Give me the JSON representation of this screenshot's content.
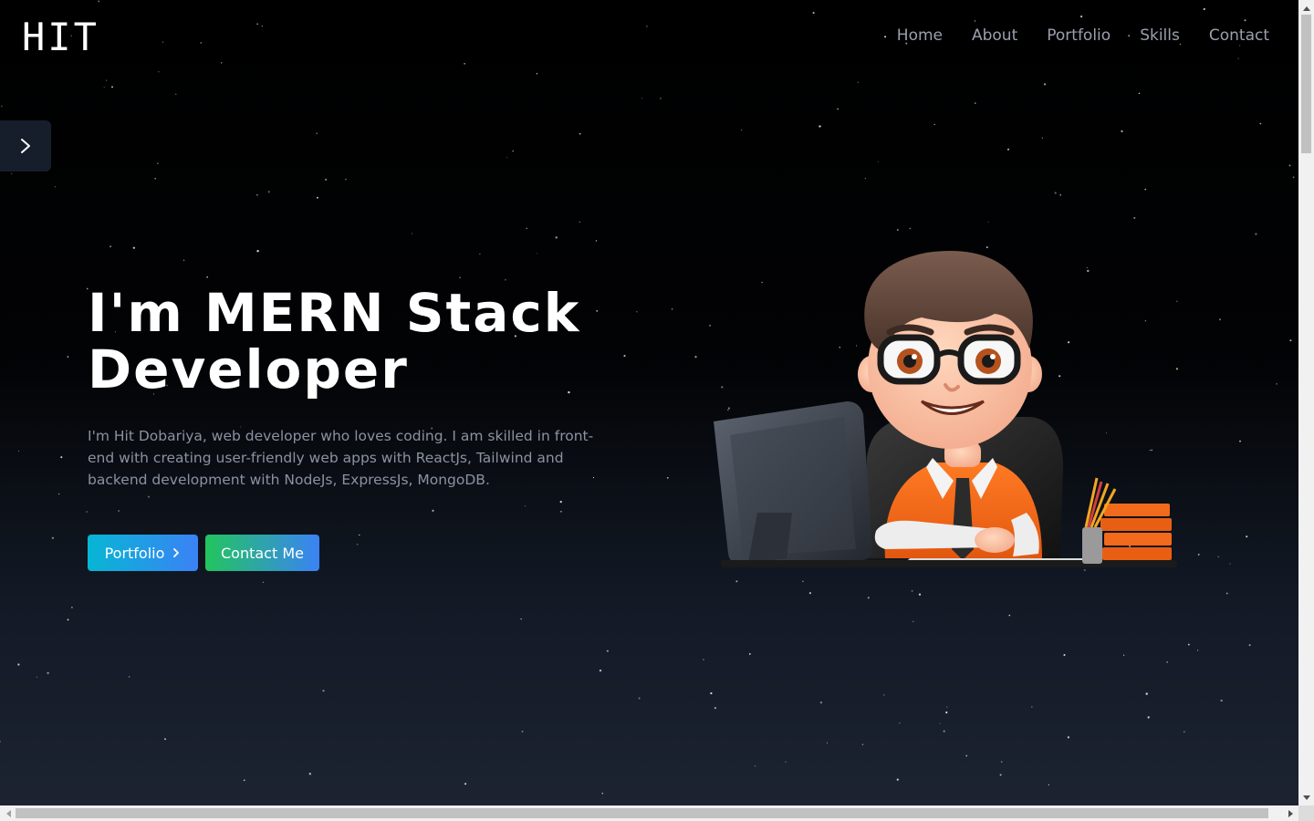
{
  "header": {
    "logo": "HIT",
    "nav": [
      "Home",
      "About",
      "Portfolio",
      "Skills",
      "Contact"
    ]
  },
  "sidebar_toggle": {
    "icon": "chevron-right-icon"
  },
  "hero": {
    "title_line1": "I'm MERN Stack",
    "title_line2": "Developer",
    "description": "I'm Hit Dobariya, web developer who loves coding. I am skilled in front-end with creating user-friendly web apps with ReactJs, Tailwind and backend development with NodeJs, ExpressJs, MongoDB.",
    "buttons": {
      "portfolio": "Portfolio",
      "contact": "Contact Me"
    },
    "illustration": "3D cartoon developer with glasses sitting at a computer desk"
  },
  "colors": {
    "background_top": "#000000",
    "background_bottom": "#1c2331",
    "nav_text": "#9aa0ad",
    "portfolio_gradient": [
      "#06b6d4",
      "#3b82f6"
    ],
    "contact_gradient": [
      "#22c55e",
      "#3b82f6"
    ],
    "accent_orange": "#f26a1b"
  }
}
